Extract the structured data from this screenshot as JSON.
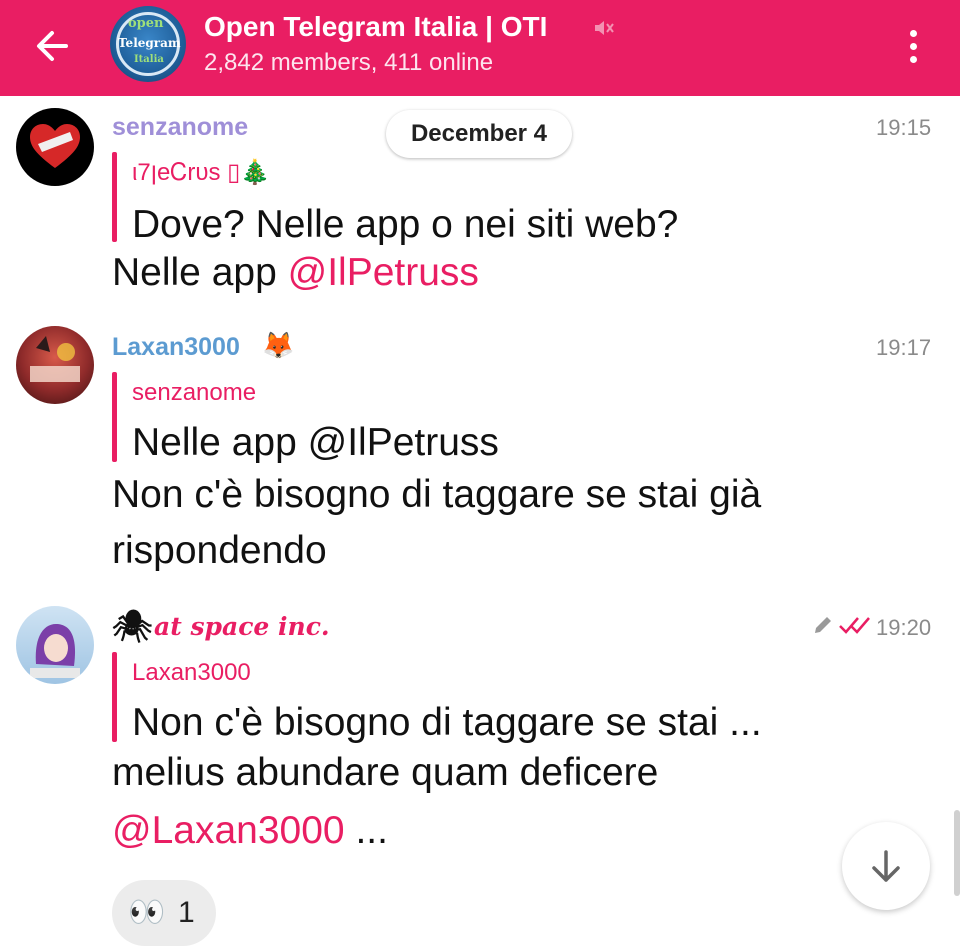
{
  "colors": {
    "header": "#E91E63",
    "accent": "#E91E63",
    "name_purple": "#9F8FD8",
    "name_blue": "#5C9BD1",
    "time": "#8A8A8A"
  },
  "header": {
    "back_icon": "arrow-left-icon",
    "avatar_text": [
      "open",
      "Telegram",
      "Italia"
    ],
    "title": "Open Telegram Italia | OTI",
    "mute_icon": "muted-speaker-icon",
    "subtitle": "2,842 members, 411 online",
    "menu_icon": "vertical-dots-icon"
  },
  "date_separator": "December 4",
  "messages": [
    {
      "sender": "senzanome",
      "time": "19:15",
      "reply_to": "ιן7eᏟrᴜs ▯🎄",
      "quoted": "Dove? Nelle app o nei siti web?",
      "text_plain": "Nelle app ",
      "text_mention": "@IlPetruss"
    },
    {
      "sender": "Laxan3000",
      "sender_badge": "🦊",
      "time": "19:17",
      "reply_to": "senzanome",
      "quoted": "Nelle app @IlPetruss",
      "text_line1": "Non c'è bisogno di taggare se stai già",
      "text_line2": "rispondendo"
    },
    {
      "sender_prefix": "🕷",
      "sender": "at space inc.",
      "time": "19:20",
      "edited_icon": "pencil-icon",
      "status_icon": "double-check-icon",
      "reply_to": "Laxan3000",
      "quoted": "Non c'è bisogno di taggare se stai ...",
      "text_line1": "melius abundare quam deficere",
      "text_mention": "@Laxan3000",
      "text_tail": " ..."
    }
  ],
  "reaction": {
    "emoji": "👀",
    "count": "1"
  },
  "scroll_down_icon": "arrow-down-icon"
}
